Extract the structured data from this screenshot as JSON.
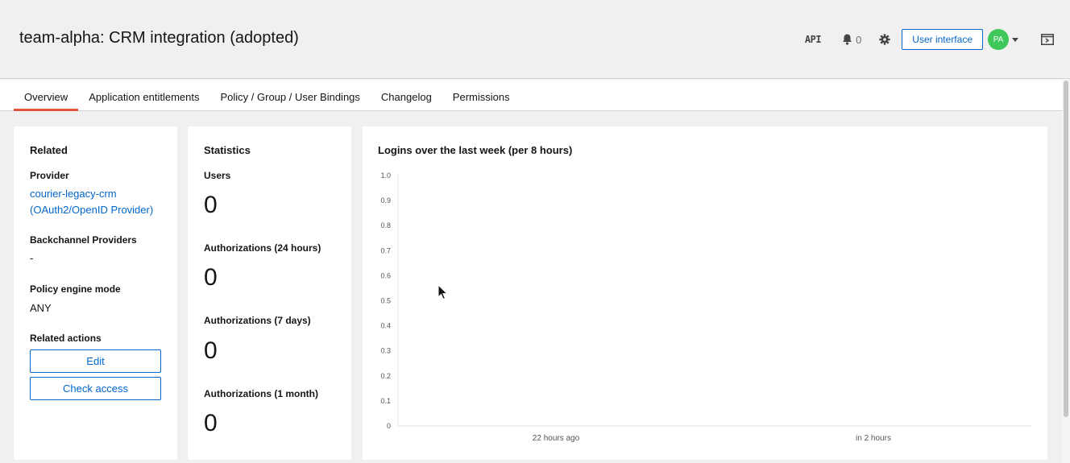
{
  "header": {
    "title": "team-alpha: CRM integration (adopted)",
    "api_label": "API",
    "notification_count": "0",
    "ui_button": "User interface",
    "avatar_initials": "PA",
    "avatar_color": "#3ec85a"
  },
  "tabs": [
    {
      "label": "Overview",
      "active": true
    },
    {
      "label": "Application entitlements",
      "active": false
    },
    {
      "label": "Policy / Group / User Bindings",
      "active": false
    },
    {
      "label": "Changelog",
      "active": false
    },
    {
      "label": "Permissions",
      "active": false
    }
  ],
  "related": {
    "title": "Related",
    "provider_label": "Provider",
    "provider_link": "courier-legacy-crm (OAuth2/OpenID Provider)",
    "backchannel_label": "Backchannel Providers",
    "backchannel_value": "-",
    "policy_label": "Policy engine mode",
    "policy_value": "ANY",
    "actions_label": "Related actions",
    "edit_button": "Edit",
    "check_access_button": "Check access"
  },
  "statistics": {
    "title": "Statistics",
    "users_label": "Users",
    "users_value": "0",
    "auth24_label": "Authorizations (24 hours)",
    "auth24_value": "0",
    "auth7_label": "Authorizations (7 days)",
    "auth7_value": "0",
    "auth1m_label": "Authorizations (1 month)",
    "auth1m_value": "0"
  },
  "chart": {
    "title": "Logins over the last week (per 8 hours)"
  },
  "chart_data": {
    "type": "line",
    "title": "Logins over the last week (per 8 hours)",
    "ylim": [
      0,
      1.0
    ],
    "y_ticks": [
      "0",
      "0.1",
      "0.2",
      "0.3",
      "0.4",
      "0.5",
      "0.6",
      "0.7",
      "0.8",
      "0.9",
      "1.0"
    ],
    "x_ticks": [
      "22 hours ago",
      "in 2 hours"
    ],
    "series": [],
    "grid": false
  },
  "colors": {
    "accent": "#0066cc",
    "tab_active": "#e0533c"
  }
}
